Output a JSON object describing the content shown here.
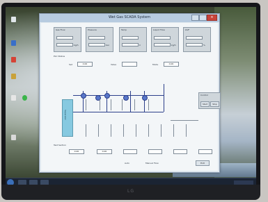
{
  "monitor": {
    "brand": "LG"
  },
  "window": {
    "title": "Wet Gas SCADA System"
  },
  "gauges": [
    {
      "caption": "Gas Flow",
      "value": "0.00",
      "unit": "kg/h"
    },
    {
      "caption": "Pressure",
      "value": "10.00",
      "unit": "bar"
    },
    {
      "caption": "Temp",
      "value": "0.00",
      "unit": "C"
    },
    {
      "caption": "Liquid Flow",
      "value": "0.00",
      "unit": "kg/h"
    },
    {
      "caption": "GVF",
      "value": "0.00",
      "unit": "%"
    }
  ],
  "row_status": {
    "label": "PLC Status"
  },
  "controls": [
    {
      "label": "Set",
      "value": "0.00"
    },
    {
      "label": "Valve",
      "value": ""
    },
    {
      "label": "Mode",
      "value": "0.00"
    }
  ],
  "tank": {
    "label": "Separator"
  },
  "side_panel": {
    "title": "Control",
    "start": "Start",
    "stop": "Stop"
  },
  "bottom": {
    "label": "Test Section",
    "fields": [
      "0.00",
      "0.00",
      "",
      "",
      "",
      ""
    ],
    "checks": [
      "Auto",
      "Manual Flow"
    ],
    "exit": "Exit"
  }
}
